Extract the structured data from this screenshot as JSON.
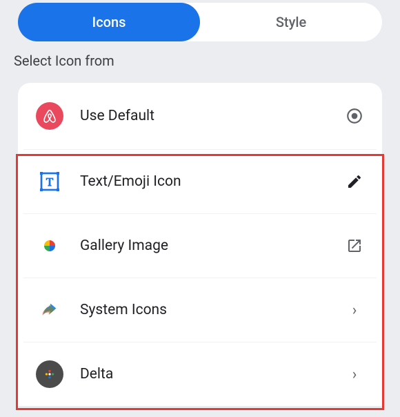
{
  "tabs": {
    "items": [
      {
        "label": "Icons"
      },
      {
        "label": "Style"
      }
    ]
  },
  "section_label": "Select Icon from",
  "options": {
    "use_default": {
      "label": "Use Default"
    },
    "text_emoji": {
      "label": "Text/Emoji Icon"
    },
    "gallery": {
      "label": "Gallery Image"
    },
    "system_icons": {
      "label": "System Icons"
    },
    "delta": {
      "label": "Delta"
    }
  }
}
